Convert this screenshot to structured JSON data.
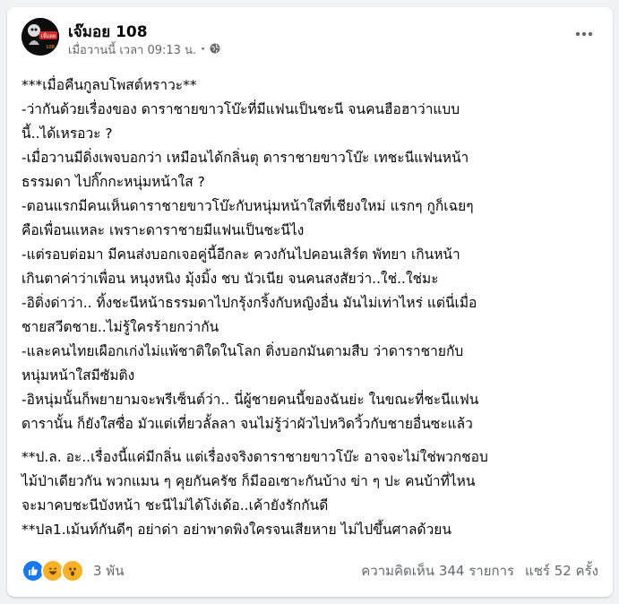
{
  "post": {
    "author": "เจ๊มอย 108",
    "avatar_text": "เจ๊มอย",
    "timestamp": "เมื่อวานนี้ เวลา 09:13 น.",
    "separator": "·",
    "privacy_icon": "globe-icon",
    "more_icon": "more-horizontal-icon",
    "lines_a": [
      "***เมื่อคืนกูลบโพสต์หราวะ**",
      "-ว่ากันด้วยเรื่องของ ดาราชายขาวโบ๊ะที่มีแฟนเป็นชะนี จนคนฮือฮาว่าแบบ",
      "นี้..ได้เหรอวะ ?",
      "-เมื่อวานมีดิ่งเพจบอกว่า เหมือนได้กลิ่นตุ ดาราชายขาวโบ๊ะ เทชะนีแฟนหน้า",
      "ธรรมดา ไปกิ๊กกะหนุ่มหน้าใส ?",
      "-ตอนแรกมีคนเห็นดาราชายขาวโบ๊ะกับหนุ่มหน้าใสที่เชียงใหม่ แรกๆ กูก็เฉยๆ",
      "คือเพื่อนแหละ เพราะดาราชายมีแฟนเป็นชะนีไง",
      "-แต่รอบต่อมา มีคนส่งบอกเจอคู่นี้อีกละ ควงกันไปคอนเสิร์ต พัทยา เกินหน้า",
      "เกินตาค่าว่าเพื่อน หนุงหนิง มุ้งมิ้ง ชบ นัวเนีย จนคนสงสัยว่า..ใช่..ใช่มะ",
      "-อิติ่งด่าว่า.. ทิ้งชะนีหน้าธรรมดาไปกรุ้งกริ้งกับหญิงอื่น มันไม่เท่าไหร่ แต่นี่เมื่อ",
      "ชายสวีตชาย..ไม่รู้ใครร้ายกว่ากัน",
      "-และคนไทยเผือกเก่งไม่แพ้ชาติใดในโลก ติ่งบอกมันตามสืบ ว่าดาราชายกับ",
      "หนุ่มหน้าใสมีซัมติง",
      "-อิหนุ่มนั้นก็พยายามจะพรีเซ็นต์ว่า.. นี่ผู้ชายคนนี้ของฉันย่ะ ในขณะที่ชะนีแฟน",
      "ดารานั้น ก็ยังใสซื่อ มัวแต่เที่ยวลั้ลลา จนไม่รู้ว่าผัวไปหวิดวิ้วกับชายอื่นซะแล้ว"
    ],
    "lines_b": [
      "**ป.ล. อะ..เรื่องนี้แค่มีกลิ่น แต่เรื่องจริงดาราชายขาวโบ๊ะ อาจจะไม่ใช่พวกชอบ",
      "ไม้ป่าเดียวกัน พวกแมน ๆ คุยกันครัช ก็มีออเซาะกันบ้าง ข่า ๆ ปะ คนบ้าที่ไหน",
      "จะมาคบชะนีบังหน้า ชะนีไม่ได้โง่เด้อ..เค้ายังรักกันดี",
      "**ปล1.เม้นท์กันดีๆ อย่าด่า อย่าพาดพิงใครจนเสียหาย ไม่ไปขึ้นศาลด้วยน"
    ],
    "reactions": {
      "icons": [
        "like-reaction-icon",
        "haha-reaction-icon",
        "wow-reaction-icon"
      ],
      "count": "3 พัน",
      "colors": {
        "like": "#1877f2",
        "haha": "#f7b125",
        "wow": "#f7b125"
      }
    },
    "comments": "ความคิดเห็น 344 รายการ",
    "shares": "แชร์ 52 ครั้ง"
  }
}
